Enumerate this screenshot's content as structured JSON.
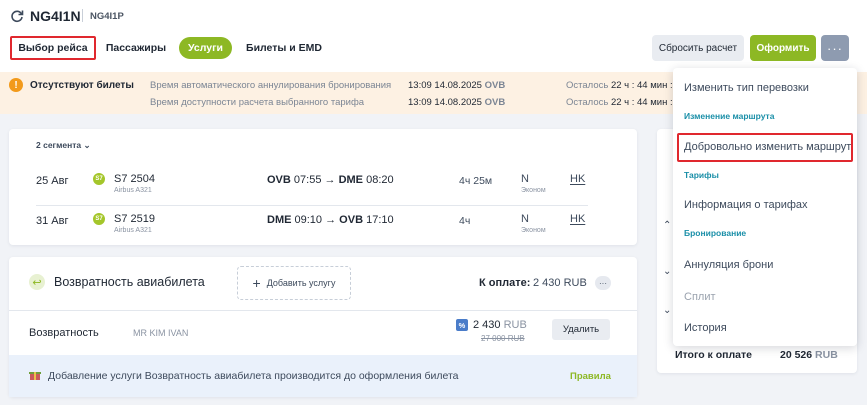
{
  "header": {
    "booking_code": "NG4I1N",
    "booking_code_secondary": "NG4I1P",
    "icons": {
      "refresh": "refresh-icon"
    }
  },
  "tabs": [
    {
      "label": "Выбор рейса"
    },
    {
      "label": "Пассажиры"
    },
    {
      "label": "Услуги"
    },
    {
      "label": "Билеты и EMD"
    }
  ],
  "actions": {
    "reset_label": "Сбросить расчет",
    "issue_label": "Оформить",
    "more_label": "···"
  },
  "alert": {
    "icon": "!",
    "title": "Отсутствуют билеты",
    "rows": [
      {
        "label": "Время автоматического аннулирования бронирования",
        "time": "13:09 14.08.2025",
        "airport": "OVB",
        "remain_prefix": "Осталось",
        "remain": "22 ч : 44 мин :"
      },
      {
        "label": "Время доступности расчета выбранного тарифа",
        "time": "13:09 14.08.2025",
        "airport": "OVB",
        "remain_prefix": "Осталось",
        "remain": "22 ч : 44 мин :"
      }
    ]
  },
  "flights": {
    "segments_label": "2 сегмента",
    "rows": [
      {
        "date": "25 Авг",
        "airline_logo": "S7",
        "number": "S7 2504",
        "aircraft": "Airbus A321",
        "from": "OVB",
        "dep": "07:55",
        "to": "DME",
        "arr": "08:20",
        "duration": "4ч 25м",
        "class": "N",
        "class_name": "Эконом",
        "status": "HK"
      },
      {
        "date": "31 Авг",
        "airline_logo": "S7",
        "number": "S7 2519",
        "aircraft": "Airbus A321",
        "from": "DME",
        "dep": "09:10",
        "to": "OVB",
        "arr": "17:10",
        "duration": "4ч",
        "class": "N",
        "class_name": "Эконом",
        "status": "HK"
      }
    ]
  },
  "service": {
    "icon": "return-icon",
    "title": "Возвратность авиабилета",
    "add_label": "Добавить услугу",
    "pay_label": "К оплате:",
    "pay_value": "2 430 RUB",
    "row": {
      "label": "Возвратность",
      "passenger": "MR KIM IVAN",
      "discount_badge": "%",
      "price": "2 430",
      "currency": "RUB",
      "old_price": "27 000 RUB",
      "delete_label": "Удалить"
    },
    "note": "Добавление услуги Возвратность авиабилета производится до оформления билета",
    "rules_label": "Правила"
  },
  "summary": {
    "total_label": "Итого к оплате",
    "total_value": "20 526",
    "currency": "RUB"
  },
  "menu": {
    "items": [
      {
        "label": "Изменить тип перевозки"
      },
      {
        "heading": "Изменение маршрута"
      },
      {
        "label": "Добровольно изменить маршрут"
      },
      {
        "heading": "Тарифы"
      },
      {
        "label": "Информация о тарифах"
      },
      {
        "heading": "Бронирование"
      },
      {
        "label": "Аннуляция брони"
      },
      {
        "label": "Сплит"
      },
      {
        "label": "История"
      }
    ]
  },
  "colors": {
    "accent": "#8db824",
    "highlight": "#e0282e",
    "heading": "#1a8fa8"
  }
}
